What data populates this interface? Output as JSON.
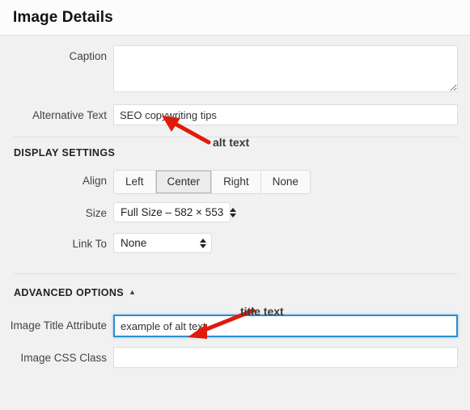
{
  "header": {
    "title": "Image Details"
  },
  "fields": {
    "caption": {
      "label": "Caption",
      "value": "",
      "placeholder": ""
    },
    "alt_text": {
      "label": "Alternative Text",
      "value": "SEO copywriting tips",
      "placeholder": ""
    },
    "image_title_attribute": {
      "label": "Image Title Attribute",
      "value": "example of alt text",
      "placeholder": ""
    },
    "image_css_class": {
      "label": "Image CSS Class",
      "value": "",
      "placeholder": ""
    }
  },
  "display_settings": {
    "heading": "DISPLAY SETTINGS",
    "align": {
      "label": "Align",
      "options": [
        "Left",
        "Center",
        "Right",
        "None"
      ],
      "selected": "Center"
    },
    "size": {
      "label": "Size",
      "selected": "Full Size – 582 × 553"
    },
    "link_to": {
      "label": "Link To",
      "selected": "None"
    }
  },
  "advanced_options": {
    "heading": "ADVANCED OPTIONS",
    "toggle_caret": "▲"
  },
  "annotations": [
    {
      "text": "alt text"
    },
    {
      "text": "title text"
    }
  ],
  "colors": {
    "annotation_red": "#e01b0c",
    "focus_blue": "#2b8fd0",
    "body_bg": "#f1f1f1"
  }
}
